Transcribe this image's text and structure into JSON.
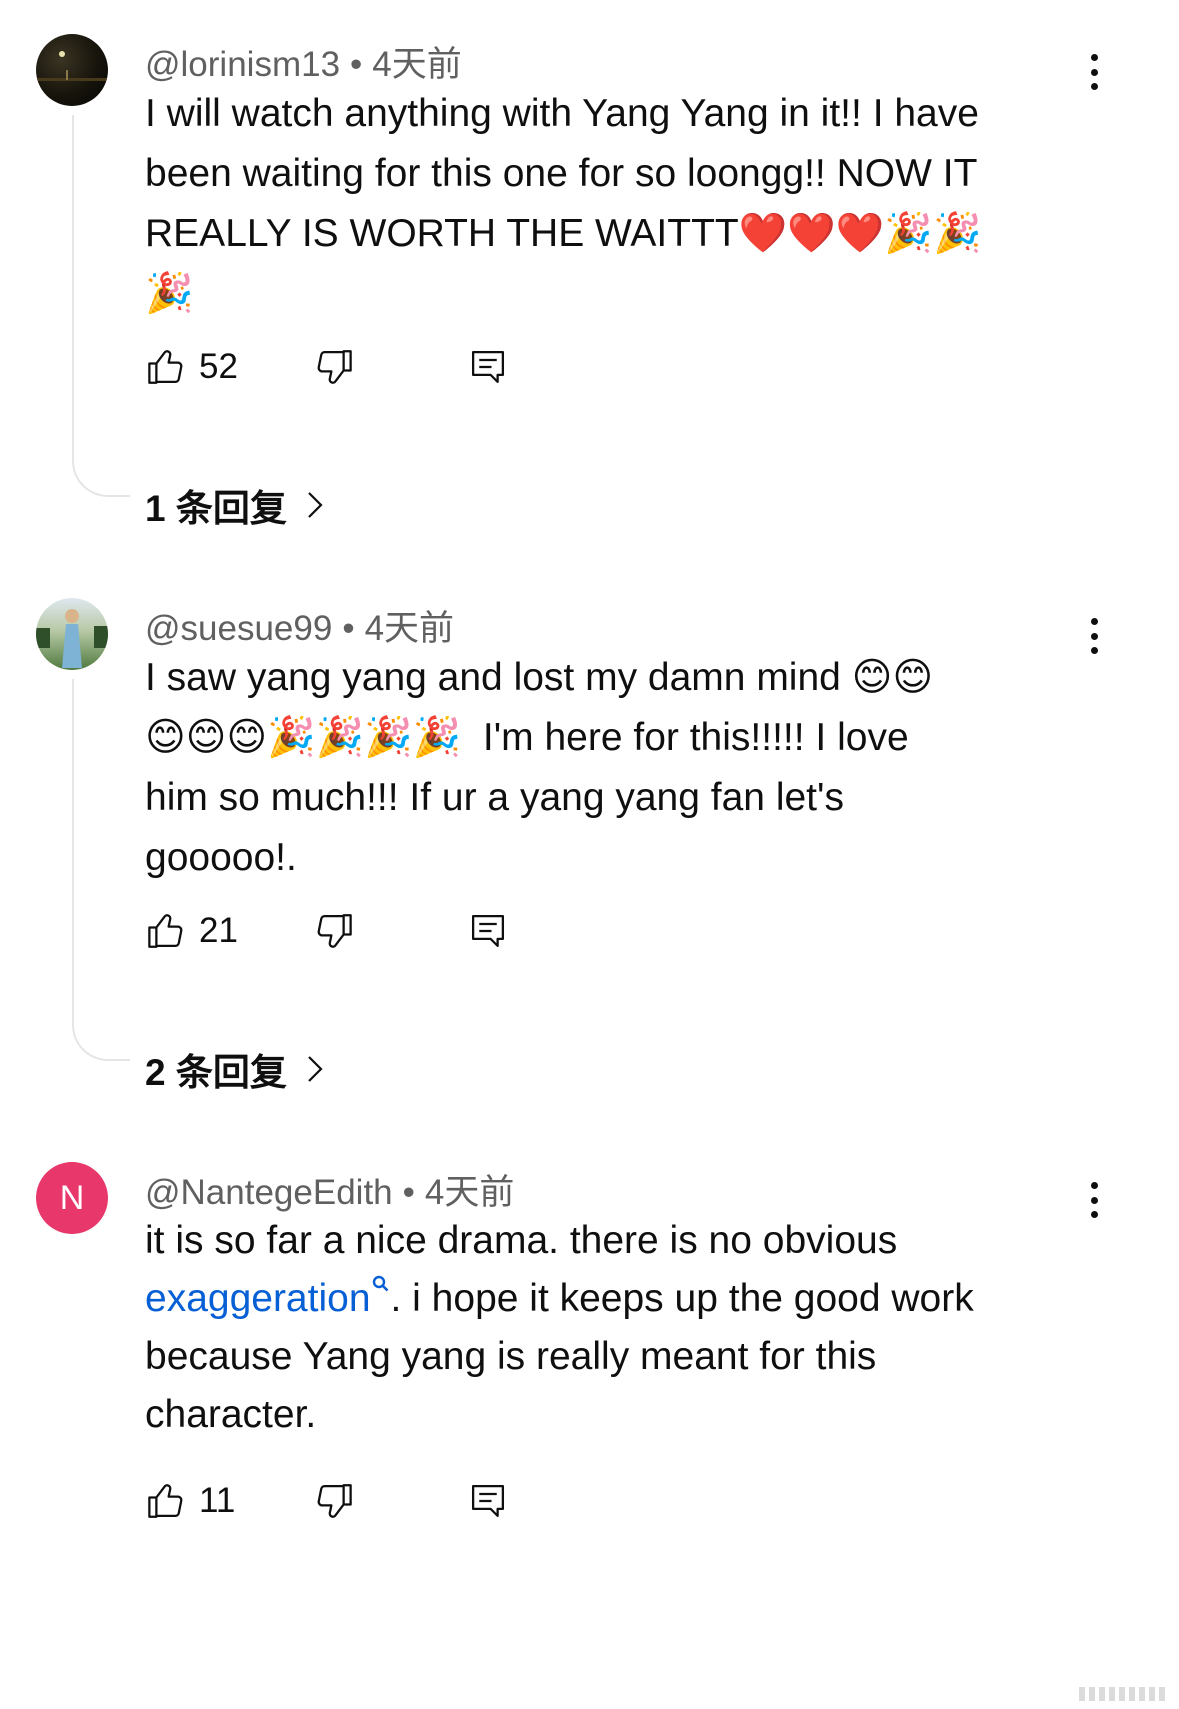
{
  "comments": [
    {
      "handle": "@lorinism13",
      "time": "4天前",
      "text_lines": [
        "I will watch anything with Yang Yang in it!! I have",
        "been waiting for this one for so loongg!! NOW IT",
        "REALLY IS WORTH THE WAITTT❤️❤️❤️🎉🎉",
        "🎉"
      ],
      "likes": "52",
      "replies": "1 条回复",
      "avatar_colors": [
        "#2b2418",
        "#0c0b08"
      ]
    },
    {
      "handle": "@suesue99",
      "time": "4天前",
      "text_lines": [
        "I saw yang yang and lost my damn mind 😊😊",
        "😊😊😊🎉🎉🎉🎉  I'm here for this!!!!! I love",
        "him so much!!! If ur a yang yang fan let's",
        "gooooo!."
      ],
      "likes": "21",
      "replies": "2 条回复",
      "avatar_colors": [
        "#6b8f5a",
        "#dfe8ef"
      ]
    },
    {
      "handle": "@NantegeEdith",
      "time": "4天前",
      "avatar_letter": "N",
      "avatar_color": "#e8386b",
      "text_line1": "it is so far a nice drama. there is no obvious",
      "link_text": "exaggeration",
      "text_line2_rest": ". i hope it keeps up the good work",
      "text_line3": "because Yang yang is really meant for this",
      "text_line4": "character.",
      "likes": "11"
    }
  ],
  "colors": {
    "link": "#065fd4",
    "meta": "#606060",
    "thread_line": "#e5e5e5"
  },
  "icons": [
    "thumbs-up-icon",
    "thumbs-down-icon",
    "reply-icon",
    "more-vert-icon",
    "chevron-right-icon",
    "search-icon"
  ]
}
